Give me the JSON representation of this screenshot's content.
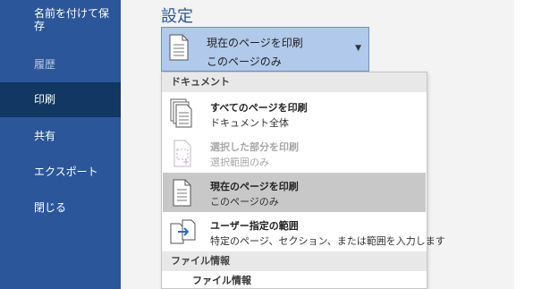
{
  "nav": {
    "items": [
      {
        "label": "名前を付けて保存"
      },
      {
        "label": "履歴"
      },
      {
        "label": "印刷"
      },
      {
        "label": "共有"
      },
      {
        "label": "エクスポート"
      },
      {
        "label": "閉じる"
      }
    ]
  },
  "settings": {
    "title": "設定",
    "select": {
      "line1": "現在のページを印刷",
      "line2": "このページのみ"
    }
  },
  "dropdown": {
    "group1": "ドキュメント",
    "options": [
      {
        "title": "すべてのページを印刷",
        "desc": "ドキュメント全体",
        "icon": "all-pages-icon",
        "state": "enabled"
      },
      {
        "title": "選択した部分を印刷",
        "desc": "選択範囲のみ",
        "icon": "selection-icon",
        "state": "disabled"
      },
      {
        "title": "現在のページを印刷",
        "desc": "このページのみ",
        "icon": "current-page-icon",
        "state": "selected"
      },
      {
        "title": "ユーザー指定の範囲",
        "desc": "特定のページ、セクション、または範囲を入力します",
        "icon": "custom-range-icon",
        "state": "enabled"
      }
    ],
    "group2": "ファイル情報",
    "sub_item": "ファイル情報"
  },
  "colors": {
    "nav": "#2b579a",
    "nav_active": "#123763",
    "accent": "#2b579a"
  }
}
